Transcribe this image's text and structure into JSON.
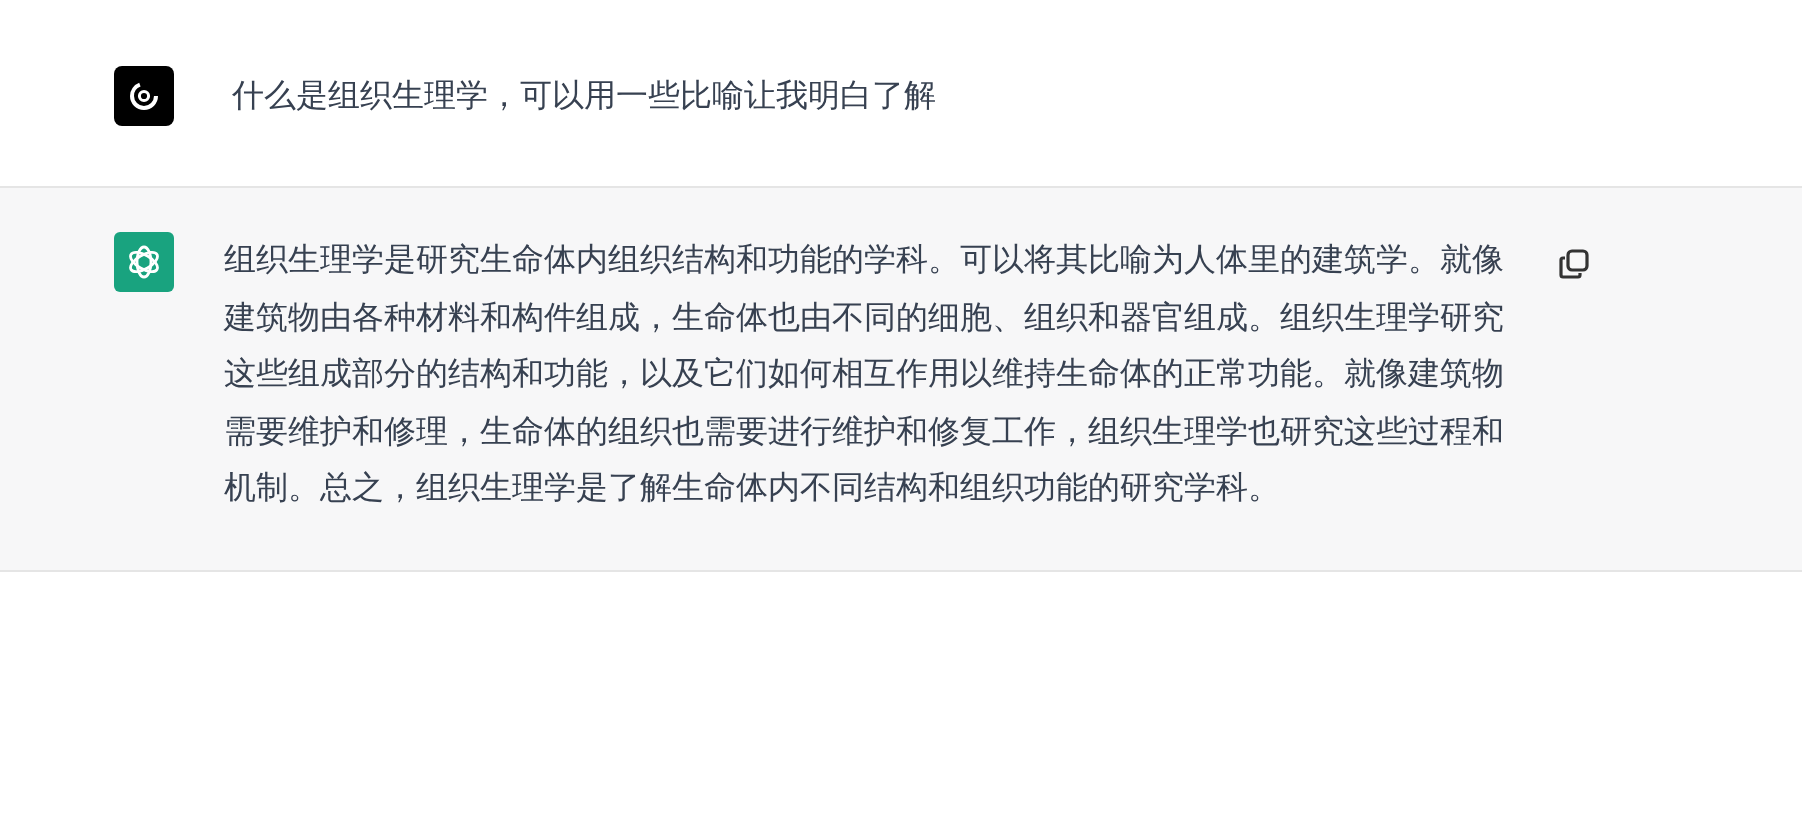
{
  "messages": [
    {
      "kind": "user",
      "text": "什么是组织生理学，可以用一些比喻让我明白了解"
    },
    {
      "kind": "assistant",
      "text": "组织生理学是研究生命体内组织结构和功能的学科。可以将其比喻为人体里的建筑学。就像建筑物由各种材料和构件组成，生命体也由不同的细胞、组织和器官组成。组织生理学研究这些组成部分的结构和功能，以及它们如何相互作用以维持生命体的正常功能。就像建筑物需要维护和修理，生命体的组织也需要进行维护和修复工作，组织生理学也研究这些过程和机制。总之，组织生理学是了解生命体内不同结构和组织功能的研究学科。"
    }
  ]
}
